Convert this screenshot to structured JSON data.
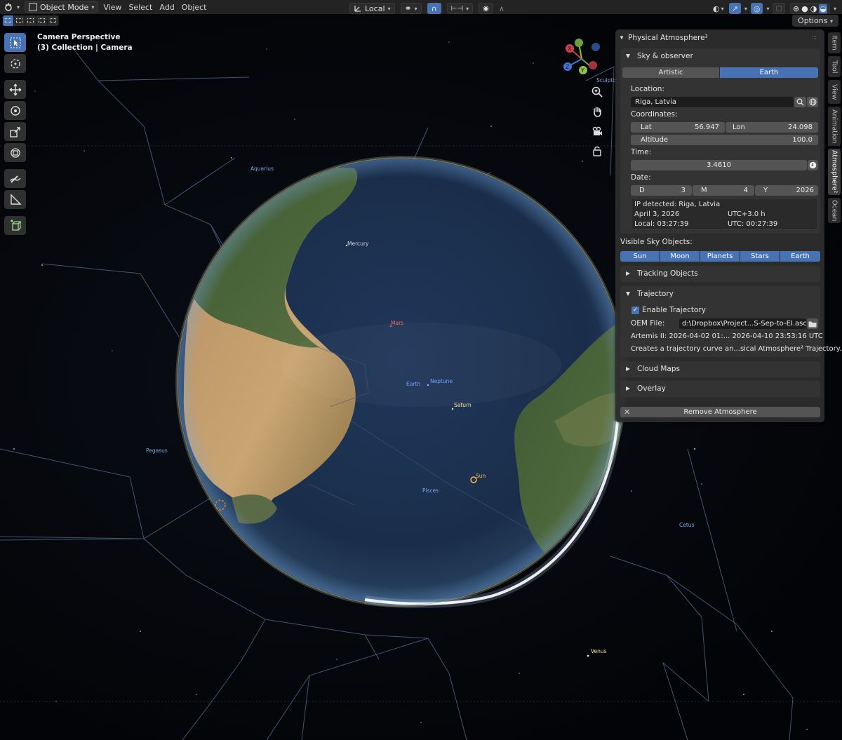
{
  "header": {
    "mode": "Object Mode",
    "menu": [
      "View",
      "Select",
      "Add",
      "Object"
    ],
    "orientation": "Local",
    "options": "Options"
  },
  "viewport": {
    "camera_title": "Camera Perspective",
    "camera_sub": "(3) Collection | Camera",
    "gizmo_axes": [
      "X",
      "Y",
      "Z"
    ]
  },
  "sky_labels": {
    "aquarius": "Aquarius",
    "mercury": "Mercury",
    "mars": "Mars",
    "earth": "Earth",
    "neptune": "Neptune",
    "saturn": "Saturn",
    "sun": "Sun",
    "pisces": "Pisces",
    "pegasus": "Pegasus",
    "cetus": "Cetus",
    "venus": "Venus",
    "sculptor": "Sculpto"
  },
  "sidetabs": [
    "Item",
    "Tool",
    "View",
    "Animation",
    "Atmosphere²",
    "Ocean"
  ],
  "panel": {
    "title": "Physical Atmosphere²",
    "sky_observer": {
      "header": "Sky & observer",
      "tabs": [
        "Artistic",
        "Earth"
      ],
      "location_label": "Location:",
      "location_value": "Riga, Latvia",
      "coordinates_label": "Coordinates:",
      "lat_label": "Lat",
      "lat_value": "56.947",
      "lon_label": "Lon",
      "lon_value": "24.098",
      "altitude_label": "Altitude",
      "altitude_value": "100.0",
      "time_label": "Time:",
      "time_value": "3.4610",
      "date_label": "Date:",
      "d_label": "D",
      "d_value": "3",
      "m_label": "M",
      "m_value": "4",
      "y_label": "Y",
      "y_value": "2026",
      "ip_detected": "IP detected: Riga, Latvia",
      "date_text": "April 3, 2026",
      "utc_offset": "UTC+3.0 h",
      "local_time": "Local: 03:27:39",
      "utc_time": "UTC: 00:27:39"
    },
    "visible_label": "Visible Sky Objects:",
    "visible_objects": [
      "Sun",
      "Moon",
      "Planets",
      "Stars",
      "Earth"
    ],
    "tracking": "Tracking Objects",
    "trajectory": {
      "header": "Trajectory",
      "enable": "Enable Trajectory",
      "oem_label": "OEM File:",
      "oem_value": "d:\\Dropbox\\Project...S-Sep-to-EI.asc",
      "artemis": "Artemis II: 2026-04-02 01:... 2026-04-10 23:53:16 UTC",
      "creates": "Creates a trajectory curve an...sical Atmosphere² Trajectory."
    },
    "cloud_maps": "Cloud Maps",
    "overlay": "Overlay",
    "remove": "Remove Atmosphere"
  }
}
